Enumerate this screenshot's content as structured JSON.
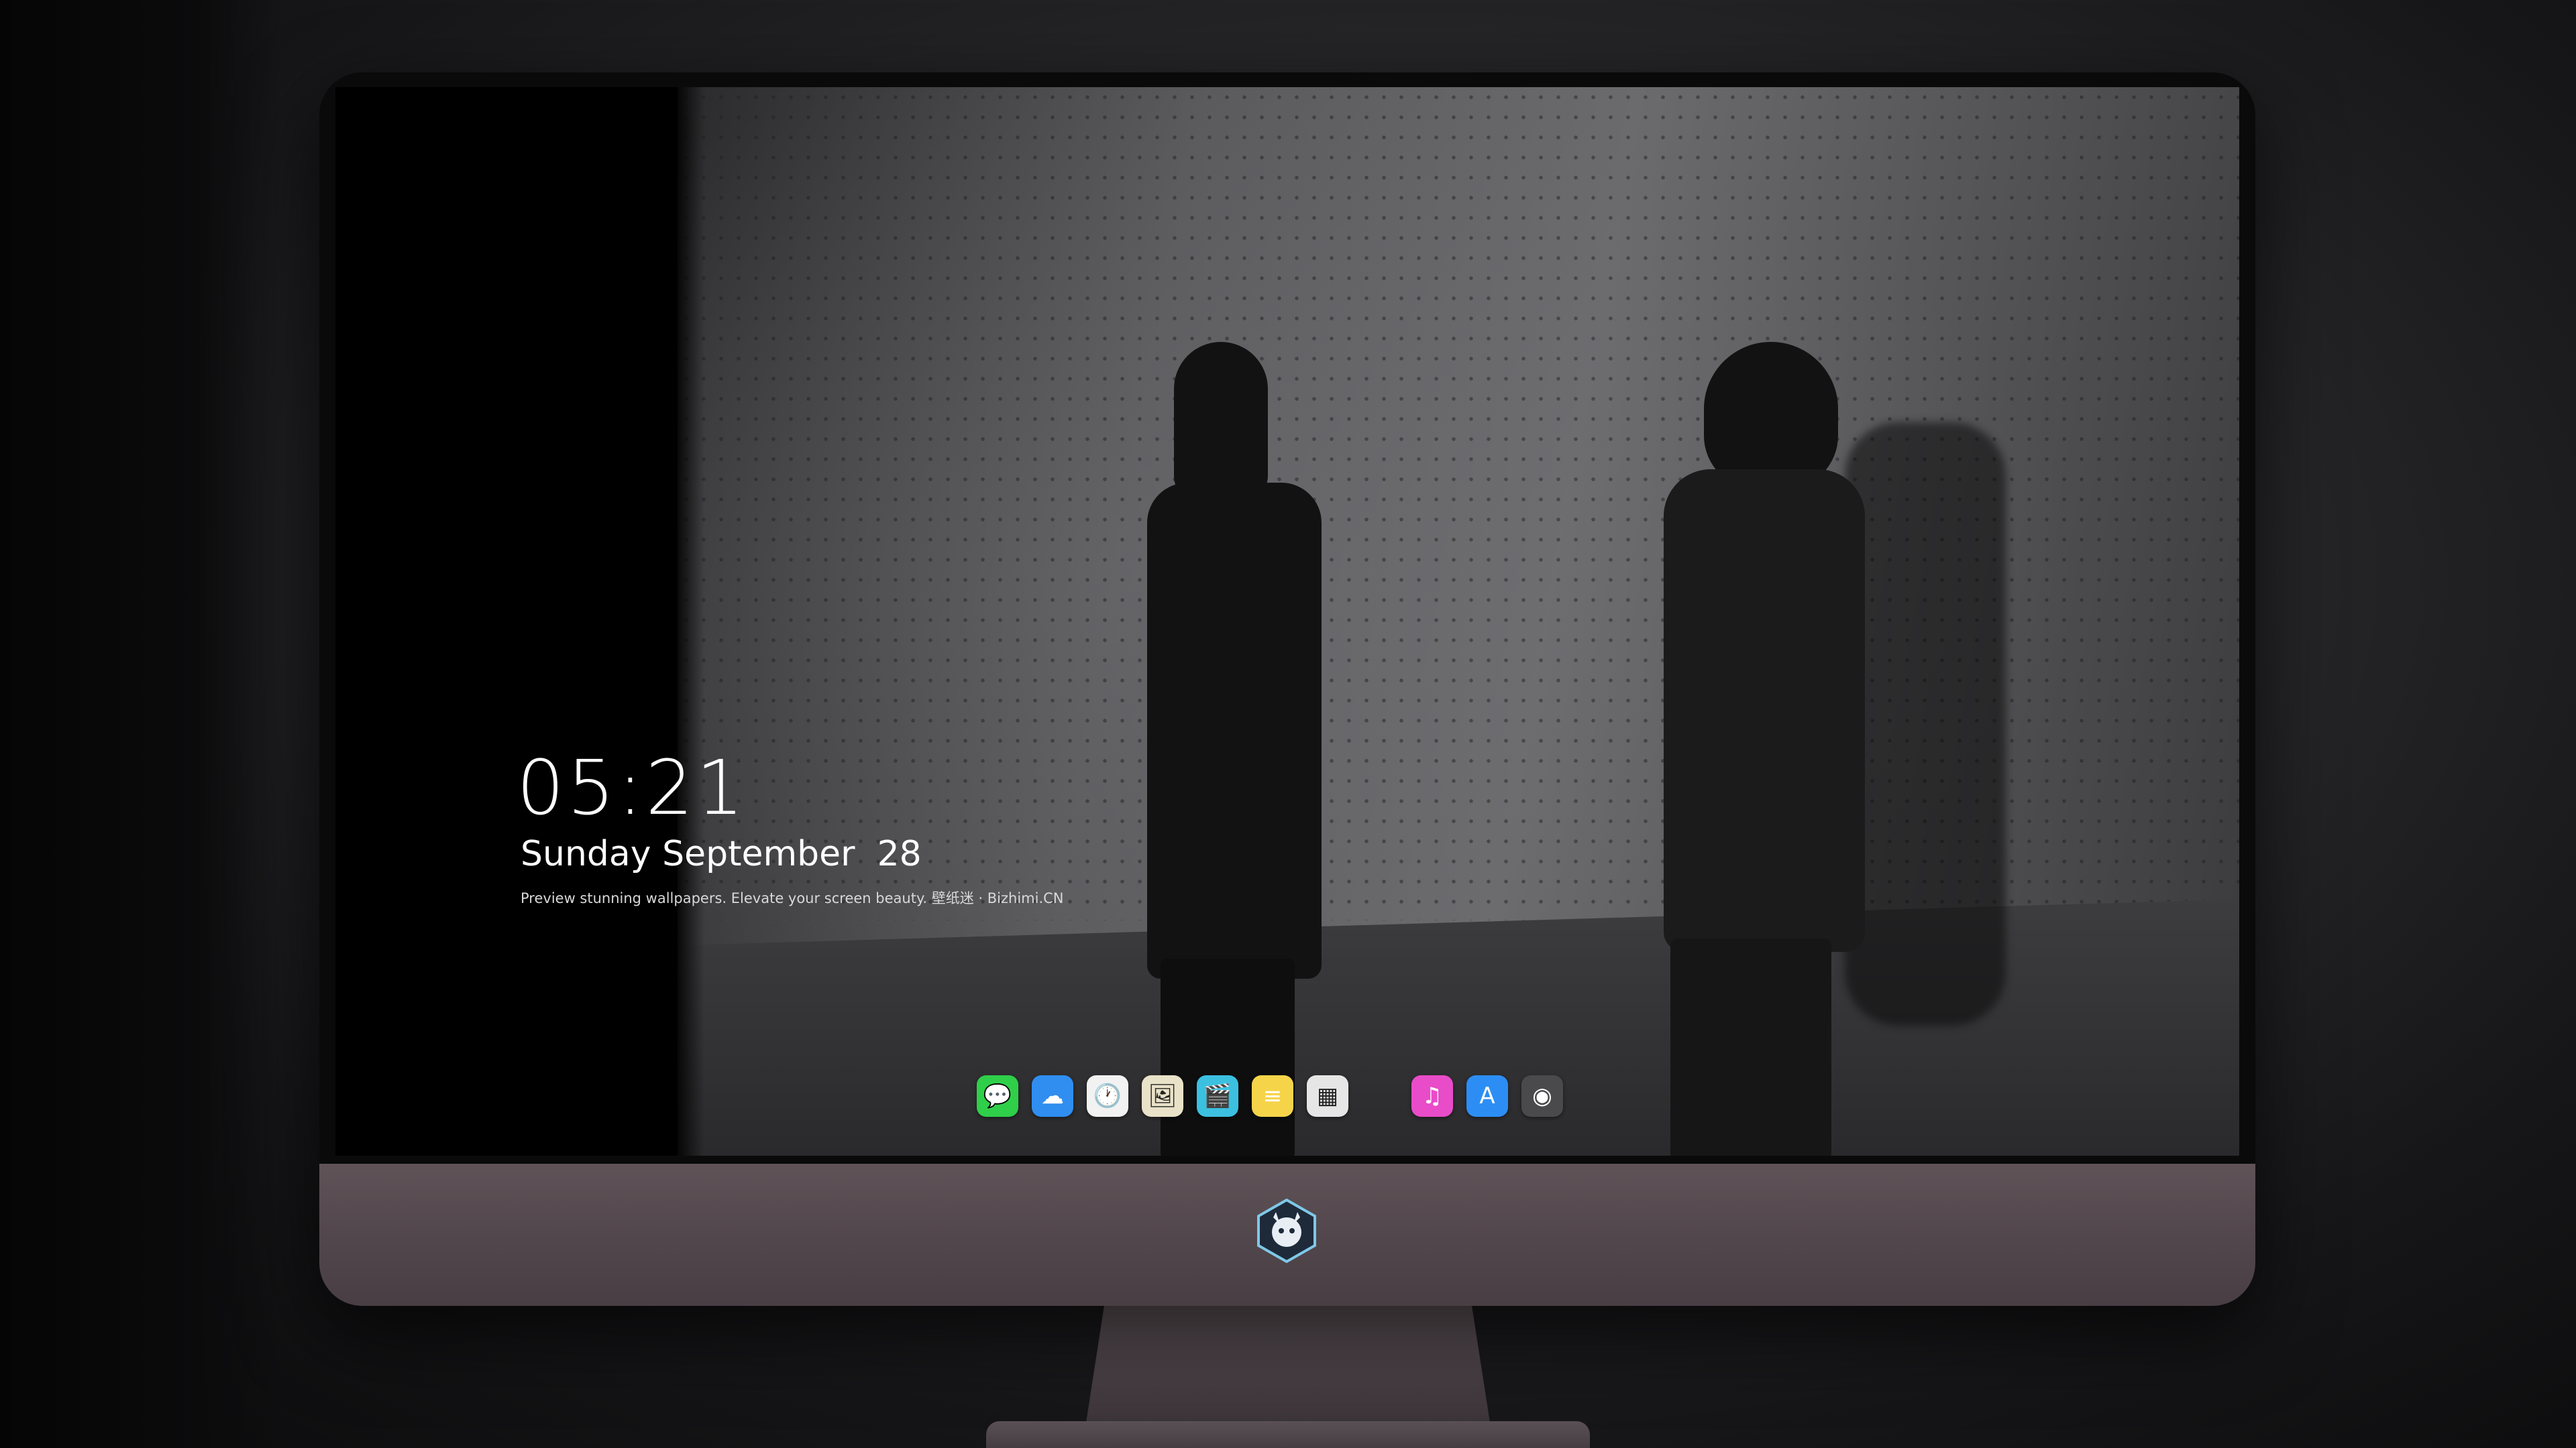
{
  "lockscreen": {
    "time": "05:21",
    "date": "Sunday September  28",
    "tagline": "Preview stunning wallpapers. Elevate your screen beauty. 壁纸迷 · Bizhimi.CN"
  },
  "dock": {
    "apps": [
      {
        "name": "messages",
        "glyph": "💬",
        "color": "#2fcf4a"
      },
      {
        "name": "weather",
        "glyph": "☁",
        "color": "#2f8ef0"
      },
      {
        "name": "clock",
        "glyph": "🕐",
        "color": "#f2f2f2"
      },
      {
        "name": "preview",
        "glyph": "🖼",
        "color": "#e9e2c8"
      },
      {
        "name": "final-cut",
        "glyph": "🎬",
        "color": "#3cc0e0"
      },
      {
        "name": "notes",
        "glyph": "≡",
        "color": "#f6d44a"
      },
      {
        "name": "photo-booth",
        "glyph": "▦",
        "color": "#e6e6e6"
      },
      {
        "name": "music",
        "glyph": "♫",
        "color": "#e94cc8"
      },
      {
        "name": "app-store",
        "glyph": "A",
        "color": "#2c8ef5"
      },
      {
        "name": "camera",
        "glyph": "◉",
        "color": "#4a4a4c"
      }
    ]
  }
}
